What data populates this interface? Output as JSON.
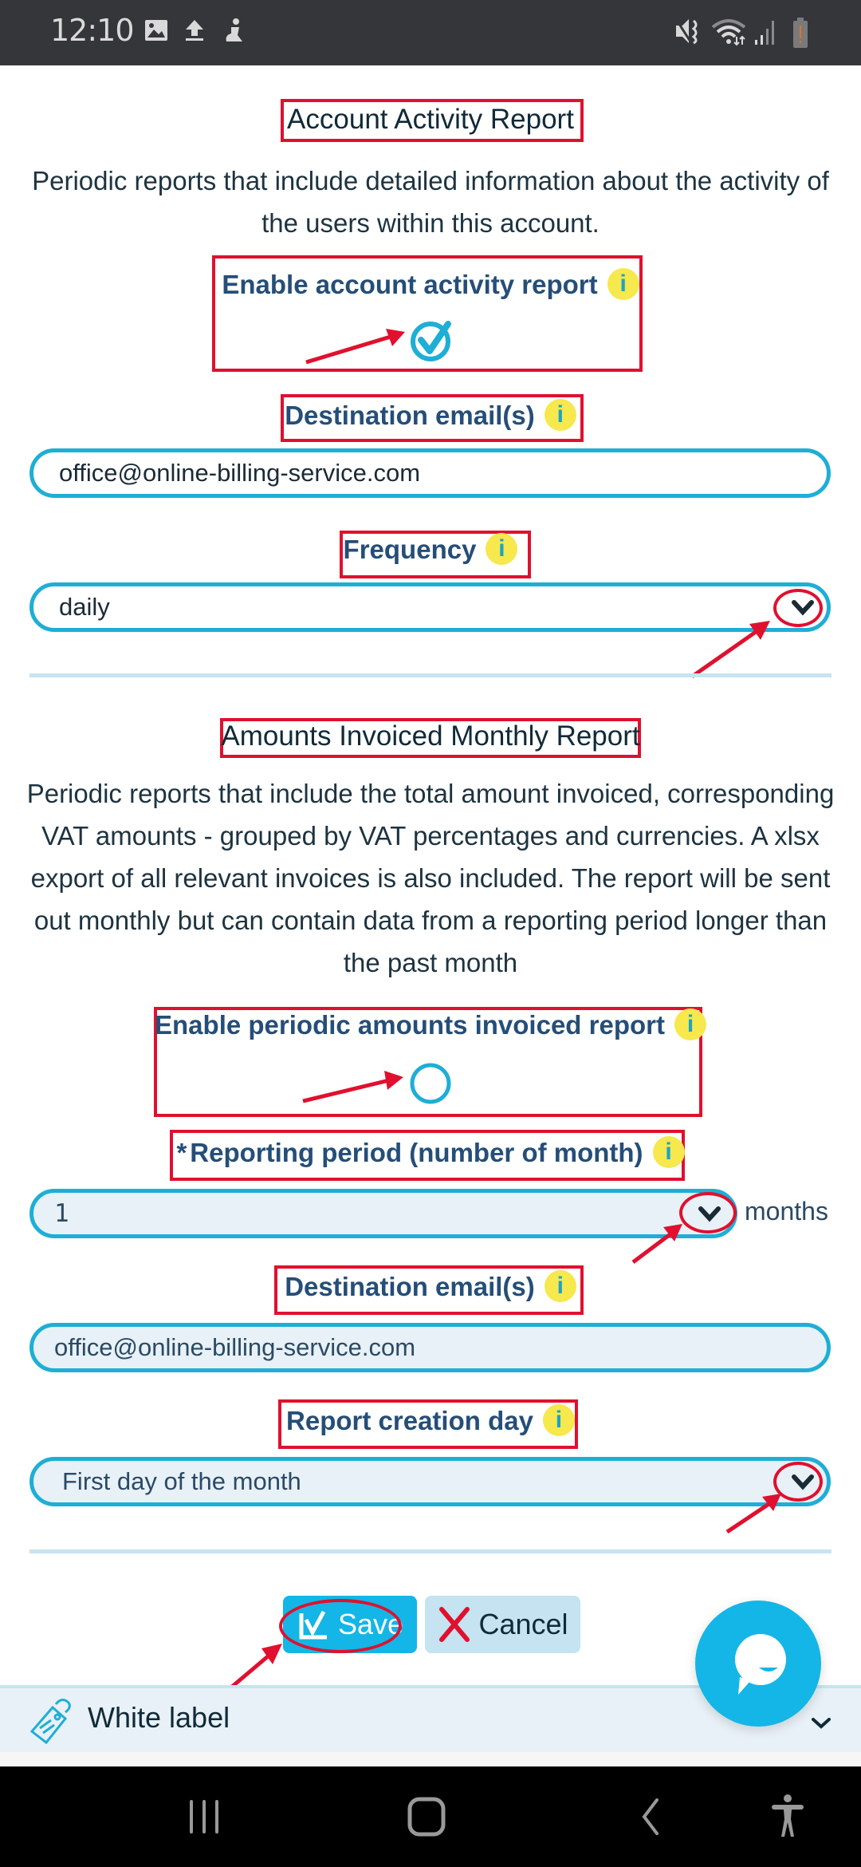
{
  "status_bar": {
    "time": "12:10",
    "left_icons": [
      "image-icon",
      "upload-icon",
      "accessibility-app-icon"
    ],
    "right_icons": [
      "mute-vibrate-icon",
      "wifi-data-icon",
      "signal-icon",
      "battery-low-icon"
    ]
  },
  "account_activity": {
    "title": "Account Activity Report",
    "description": "Periodic reports that include detailed information about the activity of the users within this account.",
    "enable_label": "Enable account activity report",
    "enable_checked": true,
    "email_label": "Destination email(s)",
    "email_value": "office@online-billing-service.com",
    "frequency_label": "Frequency",
    "frequency_value": "daily"
  },
  "amounts_invoiced": {
    "title": "Amounts Invoiced Monthly Report",
    "description": "Periodic reports that include the total amount invoiced, corresponding VAT amounts - grouped by VAT percentages and currencies. A xlsx export of all relevant invoices is also included. The report will be sent out monthly but can contain data from a reporting period longer than the past month",
    "enable_label": "Enable periodic amounts invoiced report",
    "enable_checked": false,
    "period_required_mark": "*",
    "period_label": "Reporting period (number of month)",
    "period_value": "1",
    "period_unit": "months",
    "email_label": "Destination email(s)",
    "email_value": "office@online-billing-service.com",
    "creation_day_label": "Report creation day",
    "creation_day_value": "First day of the month"
  },
  "info_glyph": "i",
  "actions": {
    "save_label": "Save",
    "cancel_label": "Cancel"
  },
  "white_label": {
    "label": "White label"
  },
  "colors": {
    "accent": "#13b6e6",
    "label_blue": "#254e78",
    "info_yellow": "#f6e84d",
    "annotation_red": "#e0102e"
  }
}
